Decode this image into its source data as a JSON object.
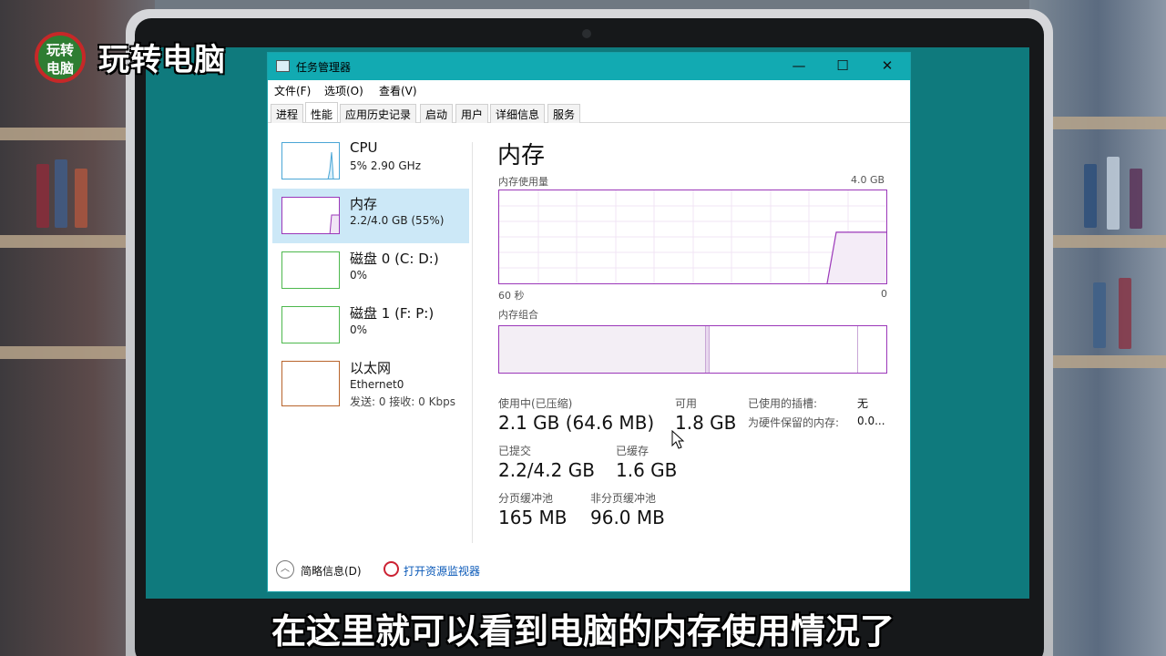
{
  "overlay": {
    "logo_circle_line1": "玩转",
    "logo_circle_line2": "电脑",
    "logo_text": "玩转电脑",
    "subtitle": "在这里就可以看到电脑的内存使用情况了"
  },
  "window": {
    "title": "任务管理器",
    "minimize_glyph": "—",
    "maximize_glyph": "☐",
    "close_glyph": "✕",
    "accent_color": "#12aab2"
  },
  "menu": [
    "文件(F)",
    "选项(O)",
    "查看(V)"
  ],
  "tabs": [
    "进程",
    "性能",
    "应用历史记录",
    "启动",
    "用户",
    "详细信息",
    "服务"
  ],
  "active_tab": "性能",
  "sidebar": [
    {
      "title": "CPU",
      "sub": "5% 2.90 GHz",
      "color": "#4aa6d6"
    },
    {
      "title": "内存",
      "sub": "2.2/4.0 GB (55%)",
      "color": "#9b37b9",
      "selected": true
    },
    {
      "title": "磁盘 0 (C: D:)",
      "sub": "0%",
      "color": "#4db84d"
    },
    {
      "title": "磁盘 1 (F: P:)",
      "sub": "0%",
      "color": "#4db84d"
    },
    {
      "title": "以太网",
      "sub": "Ethernet0",
      "sub2": "发送: 0 接收: 0 Kbps",
      "color": "#b8642b"
    }
  ],
  "memory": {
    "title": "内存",
    "usage_label": "内存使用量",
    "max_label": "4.0 GB",
    "time_left": "60 秒",
    "time_right": "0",
    "composition_label": "内存组合",
    "in_use_label": "使用中(已压缩)",
    "in_use_value": "2.1 GB (64.6 MB)",
    "available_label": "可用",
    "available_value": "1.8 GB",
    "committed_label": "已提交",
    "committed_value": "2.2/4.2 GB",
    "cached_label": "已缓存",
    "cached_value": "1.6 GB",
    "paged_label": "分页缓冲池",
    "paged_value": "165 MB",
    "nonpaged_label": "非分页缓冲池",
    "nonpaged_value": "96.0 MB",
    "slots_label": "已使用的插槽:",
    "slots_value": "无",
    "reserved_label": "为硬件保留的内存:",
    "reserved_value": "0.0...",
    "usage_fraction": 0.55
  },
  "footer": {
    "collapse_label": "简略信息(D)",
    "monitor_link": "打开资源监视器"
  }
}
